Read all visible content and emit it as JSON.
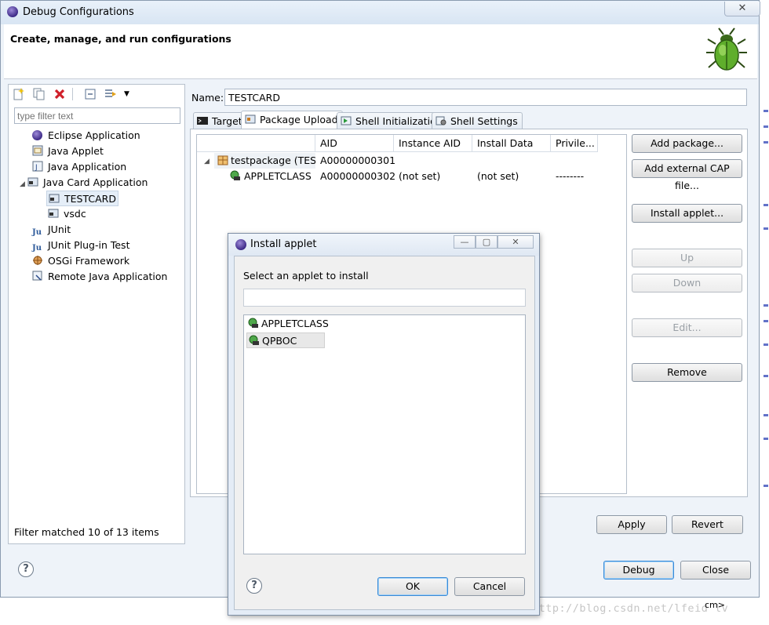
{
  "window": {
    "title": "Debug Configurations",
    "close_glyph": "✕",
    "header_text": "Create, manage, and run configurations"
  },
  "left_panel": {
    "filter_placeholder": "type filter text",
    "tree": [
      {
        "label": "Eclipse Application",
        "icon": "eclipse-icon"
      },
      {
        "label": "Java Applet",
        "icon": "java-applet-icon"
      },
      {
        "label": "Java Application",
        "icon": "java-application-icon"
      },
      {
        "label": "Java Card Application",
        "icon": "java-card-icon",
        "expanded": true
      },
      {
        "label": "TESTCARD",
        "icon": "java-card-config-icon",
        "selected": true
      },
      {
        "label": "vsdc",
        "icon": "java-card-config-icon"
      },
      {
        "label": "JUnit",
        "icon": "junit-icon"
      },
      {
        "label": "JUnit Plug-in Test",
        "icon": "junit-plugin-icon"
      },
      {
        "label": "OSGi Framework",
        "icon": "osgi-icon"
      },
      {
        "label": "Remote Java Application",
        "icon": "remote-java-icon"
      }
    ],
    "filter_status": "Filter matched 10 of 13 items"
  },
  "config": {
    "name_label": "Name:",
    "name_value": "TESTCARD",
    "tabs": [
      "Target",
      "Package Upload",
      "Shell Initialization",
      "Shell Settings"
    ],
    "active_tab": "Package Upload",
    "table": {
      "columns": [
        "",
        "AID",
        "Instance AID",
        "Install Data",
        "Privile..."
      ],
      "rows": [
        {
          "name": "testpackage (TEST",
          "aid": "A00000000301",
          "instance_aid": "",
          "install_data": "",
          "privileges": ""
        },
        {
          "name": "APPLETCLASS",
          "aid": "A00000000302",
          "instance_aid": "(not set)",
          "install_data": "(not set)",
          "privileges": "--------"
        }
      ]
    },
    "side_buttons": {
      "add_package": "Add package...",
      "add_external_cap": "Add external CAP file...",
      "install_applet": "Install applet...",
      "up": "Up",
      "down": "Down",
      "edit": "Edit...",
      "remove": "Remove"
    },
    "apply": "Apply",
    "revert": "Revert"
  },
  "footer": {
    "help": "?",
    "debug": "Debug",
    "close": "Close"
  },
  "dialog": {
    "title": "Install applet",
    "prompt": "Select an applet to install",
    "filter_value": "",
    "items": [
      "APPLETCLASS",
      "QPBOC"
    ],
    "selected_item": "QPBOC",
    "ok": "OK",
    "cancel": "Cancel",
    "help": "?",
    "min_glyph": "—",
    "max_glyph": "▢",
    "close_glyph": "✕"
  },
  "taskbar": {
    "cm_label": "cm>",
    "watermark": "http://blog.csdn.net/lfeid lv"
  },
  "colors": {
    "accent": "#3a8ad6",
    "window_bg": "#eef3f9",
    "selection": "#e5eef8"
  }
}
